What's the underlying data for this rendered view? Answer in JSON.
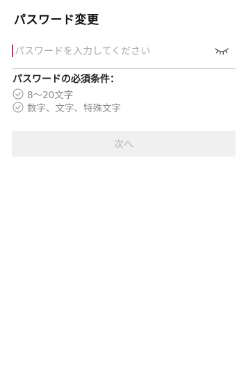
{
  "header": {
    "title": "パスワード変更"
  },
  "password_field": {
    "value": "",
    "placeholder": "パスワードを入力してください",
    "visibility_icon": "eye-closed-icon"
  },
  "requirements": {
    "title": "パスワードの必須条件：",
    "items": [
      {
        "label": "8〜20文字",
        "icon": "check-circle-icon",
        "satisfied": false
      },
      {
        "label": "数字、文字、特殊文字",
        "icon": "check-circle-icon",
        "satisfied": false
      }
    ]
  },
  "actions": {
    "next_label": "次へ",
    "next_enabled": false
  },
  "colors": {
    "caret": "#e0245e",
    "button_bg_disabled": "#f0f0f0",
    "button_text_disabled": "#b4b4b4",
    "muted_text": "#8a8a8a"
  }
}
